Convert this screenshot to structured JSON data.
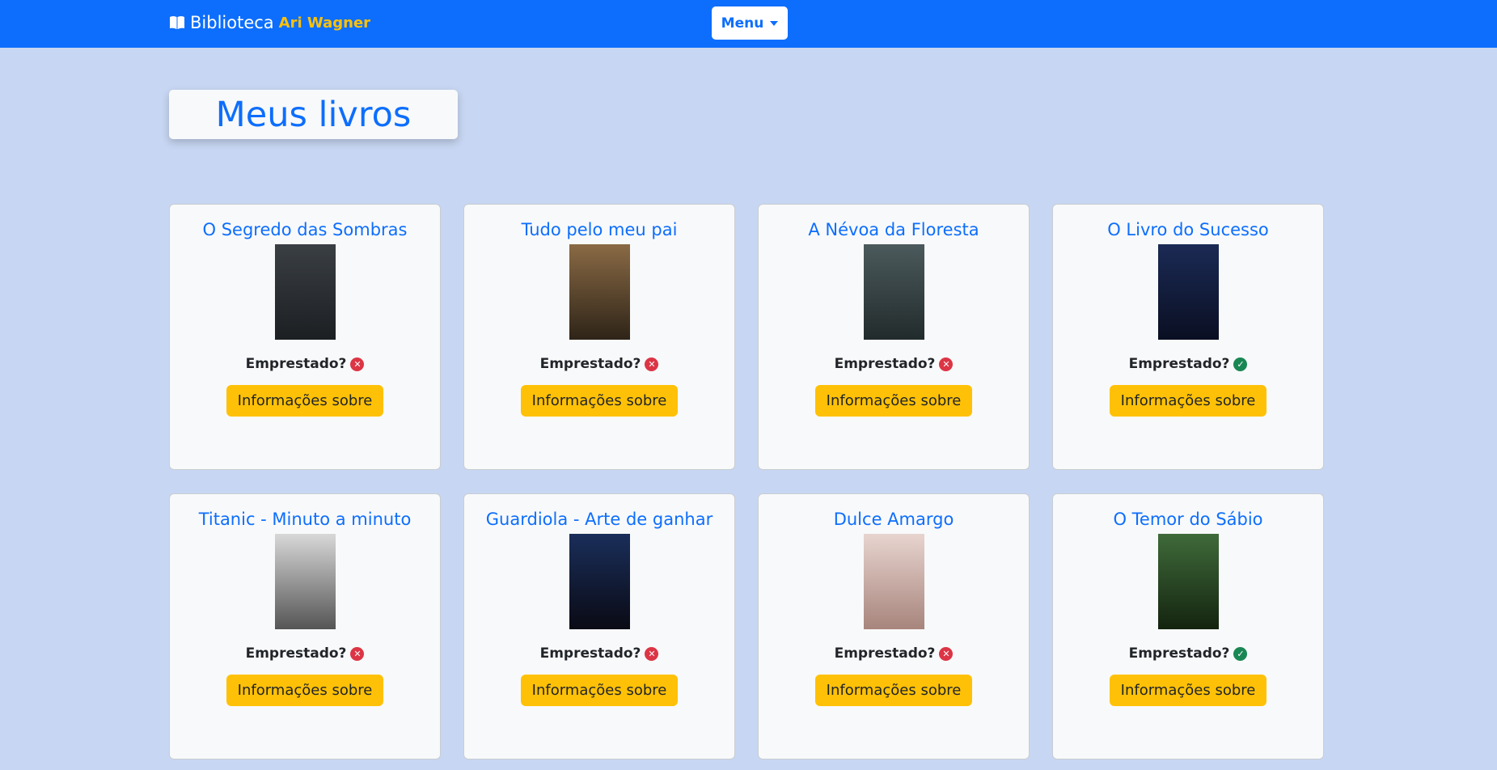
{
  "navbar": {
    "brand": "Biblioteca",
    "owner": "Ari Wagner",
    "menu_label": "Menu"
  },
  "page_title": "Meus livros",
  "colors": {
    "primary": "#0d6efd",
    "warning": "#ffc107",
    "danger": "#dc3545",
    "success": "#198754"
  },
  "books": [
    {
      "title": "O Segredo das Sombras",
      "lent_label": "Emprestado?",
      "lent": false,
      "button": "Informações sobre",
      "cover": [
        "#3a3f44",
        "#1c1f22"
      ]
    },
    {
      "title": "Tudo pelo meu pai",
      "lent_label": "Emprestado?",
      "lent": false,
      "button": "Informações sobre",
      "cover": [
        "#8a6a45",
        "#2e2418"
      ]
    },
    {
      "title": "A Névoa da Floresta",
      "lent_label": "Emprestado?",
      "lent": false,
      "button": "Informações sobre",
      "cover": [
        "#4b5a5c",
        "#222b2c"
      ]
    },
    {
      "title": "O Livro do Sucesso",
      "lent_label": "Emprestado?",
      "lent": true,
      "button": "Informações sobre",
      "cover": [
        "#1b2a55",
        "#0a0f22"
      ]
    },
    {
      "title": "Titanic - Minuto a minuto",
      "lent_label": "Emprestado?",
      "lent": false,
      "button": "Informações sobre",
      "cover": [
        "#d8d8d8",
        "#555555"
      ]
    },
    {
      "title": "Guardiola - Arte de ganhar",
      "lent_label": "Emprestado?",
      "lent": false,
      "button": "Informações sobre",
      "cover": [
        "#1a2e5a",
        "#0a0a14"
      ]
    },
    {
      "title": "Dulce Amargo",
      "lent_label": "Emprestado?",
      "lent": false,
      "button": "Informações sobre",
      "cover": [
        "#e8d4cf",
        "#a7857c"
      ]
    },
    {
      "title": "O Temor do Sábio",
      "lent_label": "Emprestado?",
      "lent": true,
      "button": "Informações sobre",
      "cover": [
        "#3f6a3a",
        "#14240f"
      ]
    }
  ]
}
